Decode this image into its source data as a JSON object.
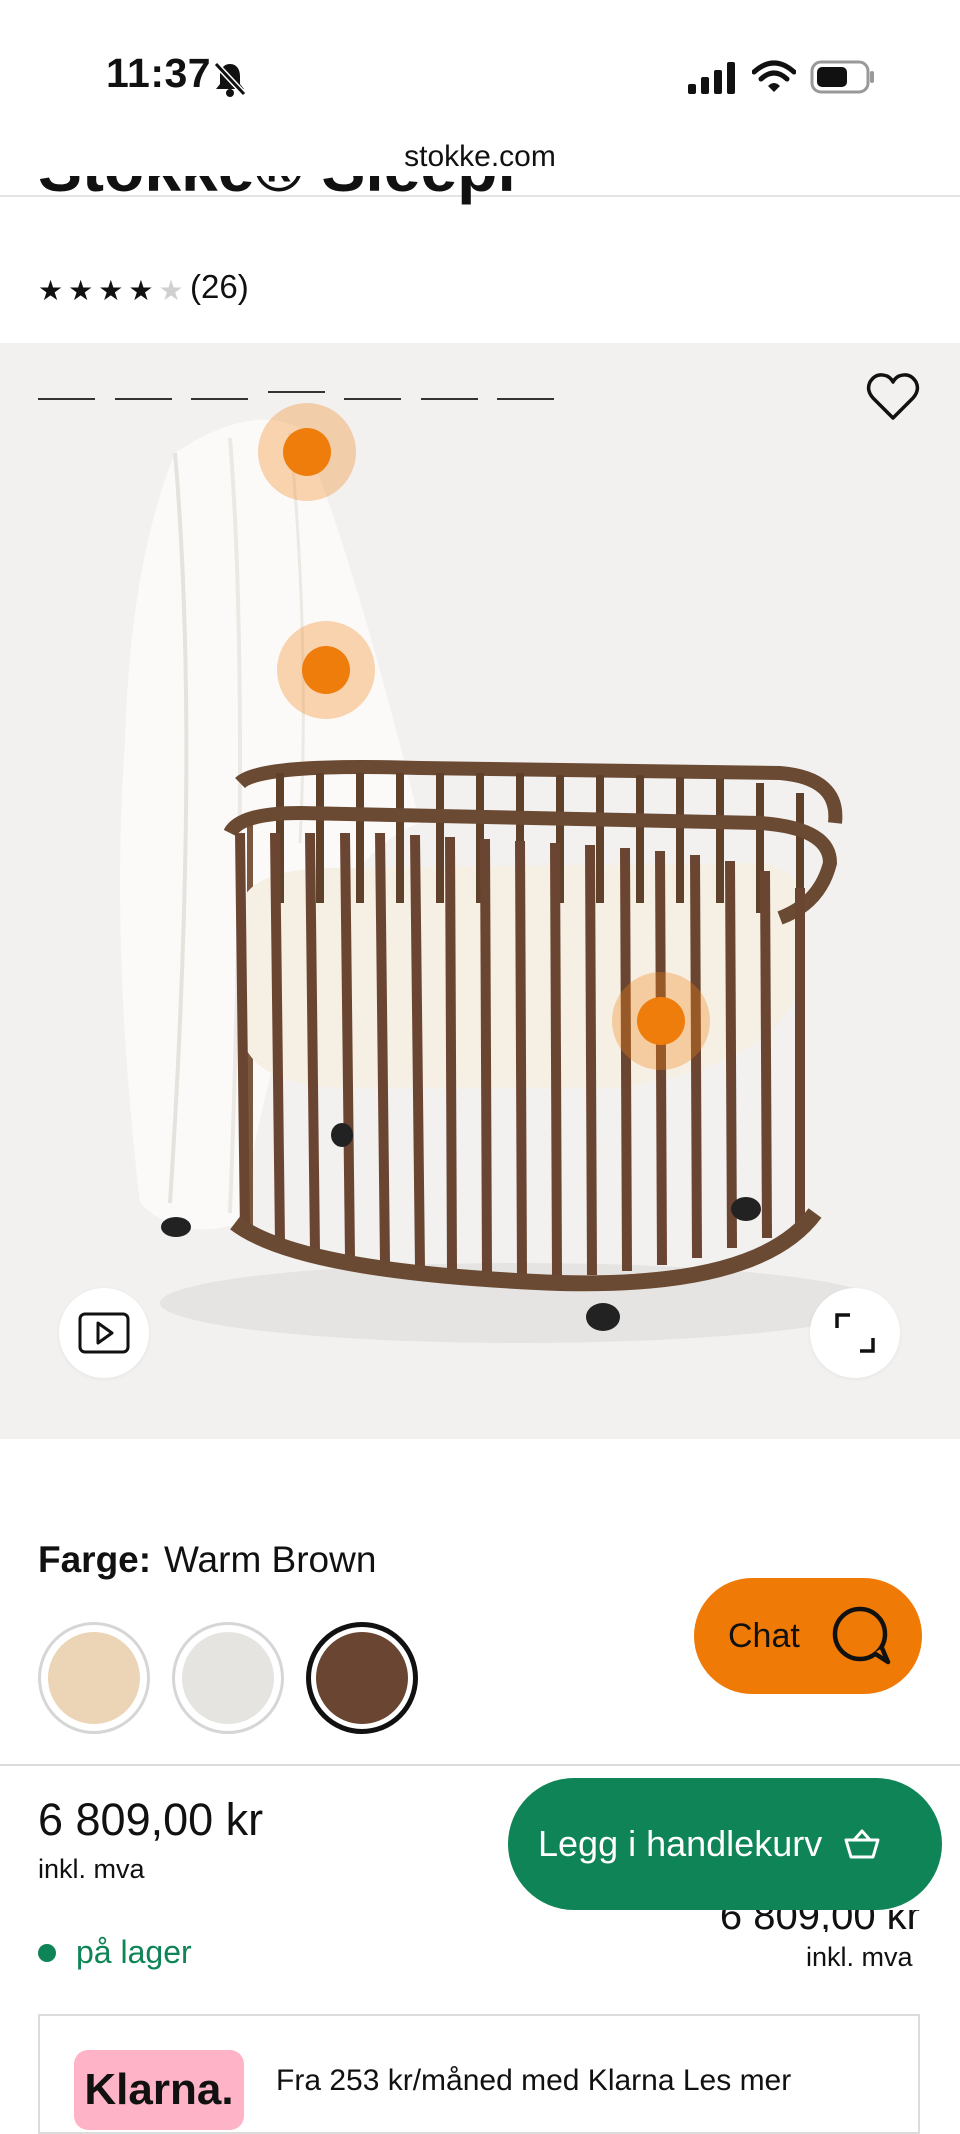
{
  "status_bar": {
    "time": "11:37"
  },
  "browser": {
    "url": "stokke.com"
  },
  "product": {
    "title": "Stokke® Sleepi™ Seng",
    "rating": 4,
    "rating_max": 5,
    "review_count": "(26)"
  },
  "gallery": {
    "image_count": 7,
    "active_index": 4
  },
  "color": {
    "label": "Farge:",
    "selected": "Warm Brown",
    "swatches": [
      {
        "name": "natural",
        "color": "#ecd5b6"
      },
      {
        "name": "white",
        "color": "#e6e4e1"
      },
      {
        "name": "warm-brown",
        "color": "#6a4632"
      }
    ],
    "selected_index": 2
  },
  "chat": {
    "label": "Chat",
    "color": "#ef7a06"
  },
  "purchase": {
    "price": "6 809,00 kr",
    "vat_note": "inkl. mva",
    "add_to_cart_label": "Legg i handlekurv",
    "cart_color": "#0f8456",
    "secondary_price": "6 809,00 kr",
    "secondary_vat_note": "inkl. mva",
    "stock_status": "på lager"
  },
  "klarna": {
    "badge": "Klarna.",
    "text": "Fra 253 kr/måned med Klarna Les mer"
  }
}
